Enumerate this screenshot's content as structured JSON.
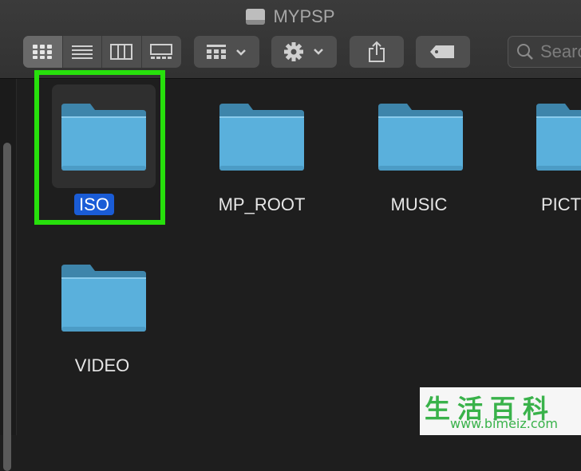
{
  "window": {
    "title": "MYPSP",
    "drive_icon": "external-drive-icon"
  },
  "toolbar": {
    "view_modes": [
      {
        "icon": "icon-view-grid",
        "active": true
      },
      {
        "icon": "list-view-icon",
        "active": false
      },
      {
        "icon": "column-view-icon",
        "active": false
      },
      {
        "icon": "gallery-view-icon",
        "active": false
      }
    ],
    "group_button_icon": "group-by-icon",
    "action_button_icon": "gear-icon",
    "share_icon": "share-icon",
    "tag_icon": "tag-icon",
    "search_placeholder": "Searc"
  },
  "items": [
    {
      "name": "ISO",
      "selected": true
    },
    {
      "name": "MP_ROOT",
      "selected": false
    },
    {
      "name": "MUSIC",
      "selected": false
    },
    {
      "name": "PICTU",
      "selected": false
    },
    {
      "name": "VIDEO",
      "selected": false
    }
  ],
  "watermark": {
    "title": "生活百科",
    "url": "www.bimeiz.com"
  },
  "colors": {
    "highlight": "#27e00c",
    "selection": "#1a5cd6",
    "folder": "#5ab0dc"
  }
}
